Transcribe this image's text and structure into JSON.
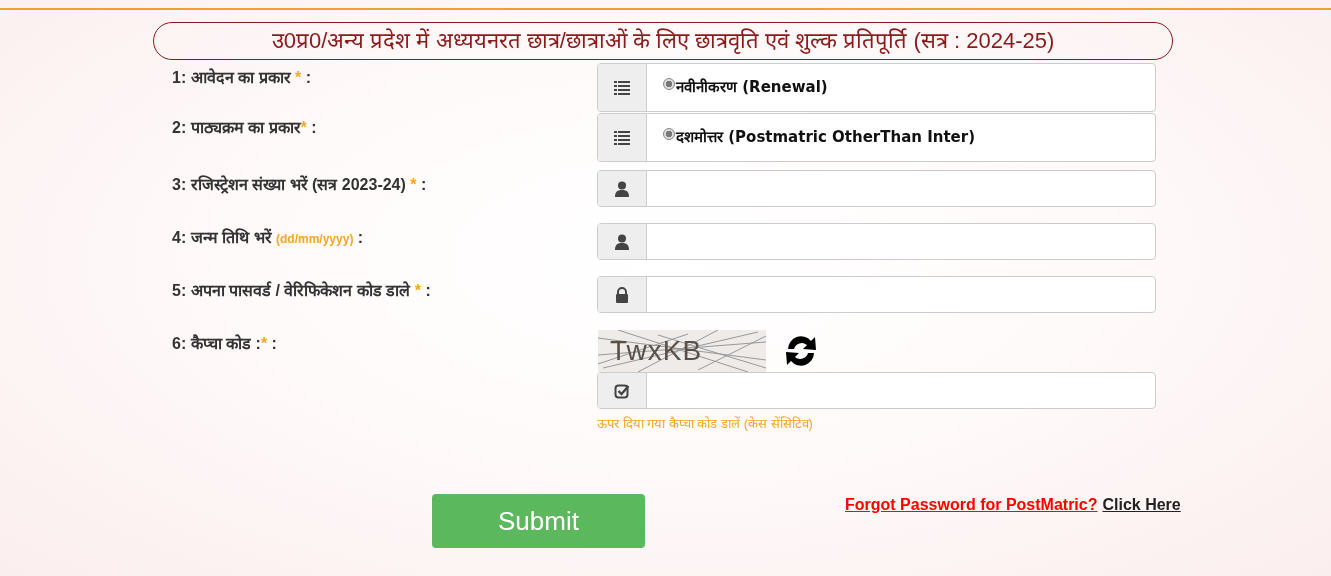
{
  "title": "उ0प्र0/अन्य प्रदेश में अध्ययनरत छात्र/छात्राओं के लिए छात्रवृति एवं शुल्क प्रतिपूर्ति (सत्र : 2024-25)",
  "fields": [
    {
      "kind": "choice",
      "label": "1: आवेदन का प्रकार ",
      "note": "*",
      "suffix": " :",
      "option": "नवीनीकरण (Renewal)",
      "selected": true
    },
    {
      "kind": "choice",
      "label": "2: पाठ्यक्रम का प्रकार",
      "note": "*",
      "suffix": " :",
      "option": "दशमोत्तर (Postmatric OtherThan Inter)",
      "selected": true
    },
    {
      "kind": "text",
      "label": "3: रजिस्ट्रेशन संख्या भरें (सत्र 2023-24) ",
      "note": "*",
      "suffix": " :"
    },
    {
      "kind": "date",
      "label": "4: जन्म तिथि भरें ",
      "note": "(dd/mm/yyyy)",
      "suffix": " :"
    },
    {
      "kind": "password",
      "label": "5: अपना पासवर्ड / वेरिफिकेशन कोड डाले ",
      "note": "*",
      "suffix": " :"
    },
    {
      "kind": "captcha",
      "label": "6: कैप्चा कोड :",
      "note": "*",
      "suffix": " :",
      "captcha": "TwxKB",
      "help": "ऊपर दिया गया कैप्चा कोड डालें (केस सेंसिटिव)"
    }
  ],
  "submit": "Submit",
  "forgot": {
    "link": "Forgot Password for PostMatric?",
    "action": "Click Here"
  }
}
